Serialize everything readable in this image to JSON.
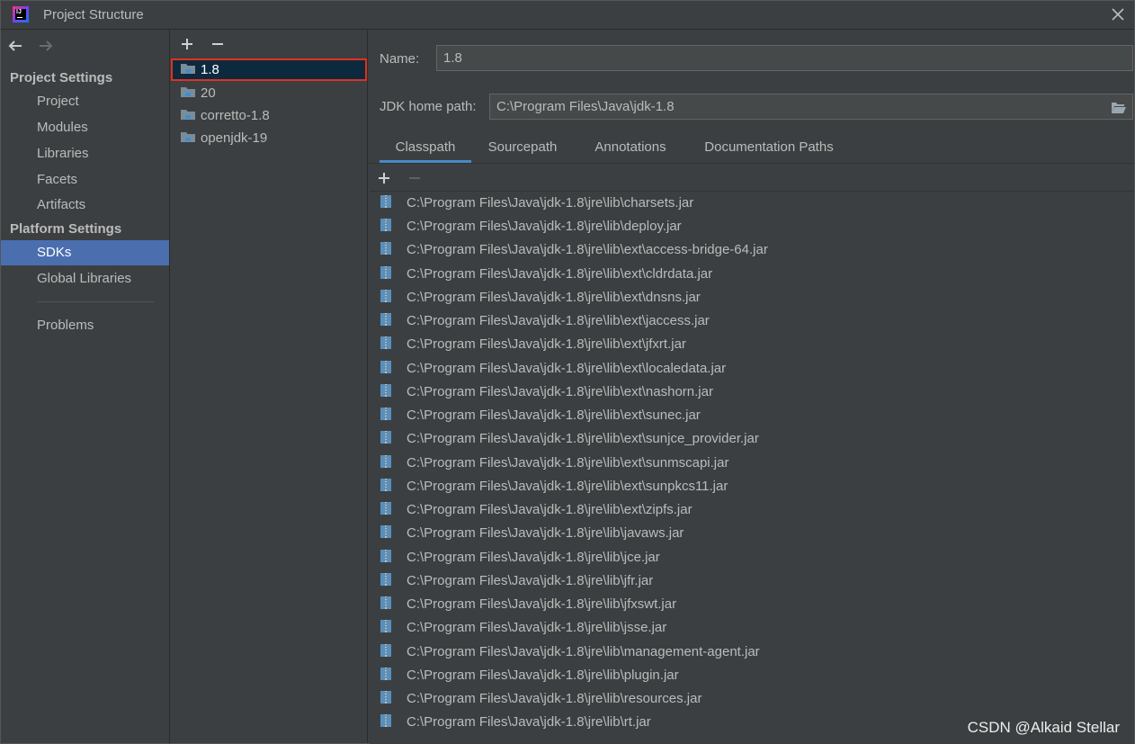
{
  "window": {
    "title": "Project Structure"
  },
  "nav": {
    "project_settings_heading": "Project Settings",
    "project_items": [
      "Project",
      "Modules",
      "Libraries",
      "Facets",
      "Artifacts"
    ],
    "platform_settings_heading": "Platform Settings",
    "platform_items": [
      "SDKs",
      "Global Libraries"
    ],
    "selected": "SDKs",
    "problems": "Problems"
  },
  "sdks": {
    "items": [
      "1.8",
      "20",
      "corretto-1.8",
      "openjdk-19"
    ],
    "selected": "1.8"
  },
  "details": {
    "name_label": "Name:",
    "name_value": "1.8",
    "home_path_label": "JDK home path:",
    "home_path_value": "C:\\Program Files\\Java\\jdk-1.8",
    "tabs": [
      "Classpath",
      "Sourcepath",
      "Annotations",
      "Documentation Paths"
    ],
    "active_tab": "Classpath",
    "classpath": [
      "C:\\Program Files\\Java\\jdk-1.8\\jre\\lib\\charsets.jar",
      "C:\\Program Files\\Java\\jdk-1.8\\jre\\lib\\deploy.jar",
      "C:\\Program Files\\Java\\jdk-1.8\\jre\\lib\\ext\\access-bridge-64.jar",
      "C:\\Program Files\\Java\\jdk-1.8\\jre\\lib\\ext\\cldrdata.jar",
      "C:\\Program Files\\Java\\jdk-1.8\\jre\\lib\\ext\\dnsns.jar",
      "C:\\Program Files\\Java\\jdk-1.8\\jre\\lib\\ext\\jaccess.jar",
      "C:\\Program Files\\Java\\jdk-1.8\\jre\\lib\\ext\\jfxrt.jar",
      "C:\\Program Files\\Java\\jdk-1.8\\jre\\lib\\ext\\localedata.jar",
      "C:\\Program Files\\Java\\jdk-1.8\\jre\\lib\\ext\\nashorn.jar",
      "C:\\Program Files\\Java\\jdk-1.8\\jre\\lib\\ext\\sunec.jar",
      "C:\\Program Files\\Java\\jdk-1.8\\jre\\lib\\ext\\sunjce_provider.jar",
      "C:\\Program Files\\Java\\jdk-1.8\\jre\\lib\\ext\\sunmscapi.jar",
      "C:\\Program Files\\Java\\jdk-1.8\\jre\\lib\\ext\\sunpkcs11.jar",
      "C:\\Program Files\\Java\\jdk-1.8\\jre\\lib\\ext\\zipfs.jar",
      "C:\\Program Files\\Java\\jdk-1.8\\jre\\lib\\javaws.jar",
      "C:\\Program Files\\Java\\jdk-1.8\\jre\\lib\\jce.jar",
      "C:\\Program Files\\Java\\jdk-1.8\\jre\\lib\\jfr.jar",
      "C:\\Program Files\\Java\\jdk-1.8\\jre\\lib\\jfxswt.jar",
      "C:\\Program Files\\Java\\jdk-1.8\\jre\\lib\\jsse.jar",
      "C:\\Program Files\\Java\\jdk-1.8\\jre\\lib\\management-agent.jar",
      "C:\\Program Files\\Java\\jdk-1.8\\jre\\lib\\plugin.jar",
      "C:\\Program Files\\Java\\jdk-1.8\\jre\\lib\\resources.jar",
      "C:\\Program Files\\Java\\jdk-1.8\\jre\\lib\\rt.jar"
    ]
  },
  "watermark": "CSDN @Alkaid Stellar",
  "icons": {
    "app": "intellij-idea-icon",
    "close": "close-icon",
    "back": "arrow-left-icon",
    "forward": "arrow-right-icon",
    "add": "plus-icon",
    "remove": "minus-icon",
    "sdk": "jdk-folder-icon",
    "browse": "folder-open-icon",
    "jar": "jar-archive-icon"
  },
  "colors": {
    "background": "#3c3f41",
    "nav_selected": "#4b6eaf",
    "sdk_selected": "#0d293e",
    "selection_highlight": "#e0301e",
    "tab_underline": "#4a88c7",
    "folder_icon": "#7b8c99",
    "jar_icon": "#5b8fb9"
  }
}
